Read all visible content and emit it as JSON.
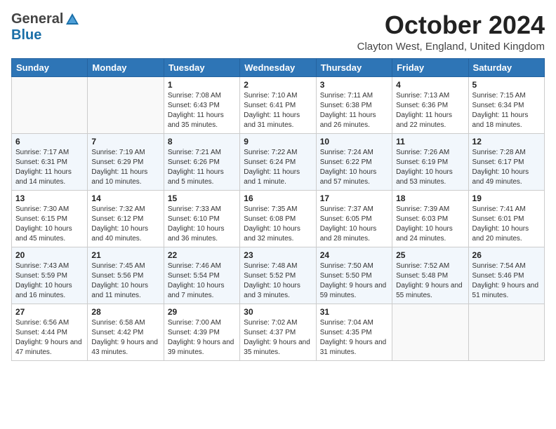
{
  "header": {
    "logo_general": "General",
    "logo_blue": "Blue",
    "month_title": "October 2024",
    "location": "Clayton West, England, United Kingdom"
  },
  "weekdays": [
    "Sunday",
    "Monday",
    "Tuesday",
    "Wednesday",
    "Thursday",
    "Friday",
    "Saturday"
  ],
  "weeks": [
    [
      {
        "day": "",
        "detail": ""
      },
      {
        "day": "",
        "detail": ""
      },
      {
        "day": "1",
        "detail": "Sunrise: 7:08 AM\nSunset: 6:43 PM\nDaylight: 11 hours and 35 minutes."
      },
      {
        "day": "2",
        "detail": "Sunrise: 7:10 AM\nSunset: 6:41 PM\nDaylight: 11 hours and 31 minutes."
      },
      {
        "day": "3",
        "detail": "Sunrise: 7:11 AM\nSunset: 6:38 PM\nDaylight: 11 hours and 26 minutes."
      },
      {
        "day": "4",
        "detail": "Sunrise: 7:13 AM\nSunset: 6:36 PM\nDaylight: 11 hours and 22 minutes."
      },
      {
        "day": "5",
        "detail": "Sunrise: 7:15 AM\nSunset: 6:34 PM\nDaylight: 11 hours and 18 minutes."
      }
    ],
    [
      {
        "day": "6",
        "detail": "Sunrise: 7:17 AM\nSunset: 6:31 PM\nDaylight: 11 hours and 14 minutes."
      },
      {
        "day": "7",
        "detail": "Sunrise: 7:19 AM\nSunset: 6:29 PM\nDaylight: 11 hours and 10 minutes."
      },
      {
        "day": "8",
        "detail": "Sunrise: 7:21 AM\nSunset: 6:26 PM\nDaylight: 11 hours and 5 minutes."
      },
      {
        "day": "9",
        "detail": "Sunrise: 7:22 AM\nSunset: 6:24 PM\nDaylight: 11 hours and 1 minute."
      },
      {
        "day": "10",
        "detail": "Sunrise: 7:24 AM\nSunset: 6:22 PM\nDaylight: 10 hours and 57 minutes."
      },
      {
        "day": "11",
        "detail": "Sunrise: 7:26 AM\nSunset: 6:19 PM\nDaylight: 10 hours and 53 minutes."
      },
      {
        "day": "12",
        "detail": "Sunrise: 7:28 AM\nSunset: 6:17 PM\nDaylight: 10 hours and 49 minutes."
      }
    ],
    [
      {
        "day": "13",
        "detail": "Sunrise: 7:30 AM\nSunset: 6:15 PM\nDaylight: 10 hours and 45 minutes."
      },
      {
        "day": "14",
        "detail": "Sunrise: 7:32 AM\nSunset: 6:12 PM\nDaylight: 10 hours and 40 minutes."
      },
      {
        "day": "15",
        "detail": "Sunrise: 7:33 AM\nSunset: 6:10 PM\nDaylight: 10 hours and 36 minutes."
      },
      {
        "day": "16",
        "detail": "Sunrise: 7:35 AM\nSunset: 6:08 PM\nDaylight: 10 hours and 32 minutes."
      },
      {
        "day": "17",
        "detail": "Sunrise: 7:37 AM\nSunset: 6:05 PM\nDaylight: 10 hours and 28 minutes."
      },
      {
        "day": "18",
        "detail": "Sunrise: 7:39 AM\nSunset: 6:03 PM\nDaylight: 10 hours and 24 minutes."
      },
      {
        "day": "19",
        "detail": "Sunrise: 7:41 AM\nSunset: 6:01 PM\nDaylight: 10 hours and 20 minutes."
      }
    ],
    [
      {
        "day": "20",
        "detail": "Sunrise: 7:43 AM\nSunset: 5:59 PM\nDaylight: 10 hours and 16 minutes."
      },
      {
        "day": "21",
        "detail": "Sunrise: 7:45 AM\nSunset: 5:56 PM\nDaylight: 10 hours and 11 minutes."
      },
      {
        "day": "22",
        "detail": "Sunrise: 7:46 AM\nSunset: 5:54 PM\nDaylight: 10 hours and 7 minutes."
      },
      {
        "day": "23",
        "detail": "Sunrise: 7:48 AM\nSunset: 5:52 PM\nDaylight: 10 hours and 3 minutes."
      },
      {
        "day": "24",
        "detail": "Sunrise: 7:50 AM\nSunset: 5:50 PM\nDaylight: 9 hours and 59 minutes."
      },
      {
        "day": "25",
        "detail": "Sunrise: 7:52 AM\nSunset: 5:48 PM\nDaylight: 9 hours and 55 minutes."
      },
      {
        "day": "26",
        "detail": "Sunrise: 7:54 AM\nSunset: 5:46 PM\nDaylight: 9 hours and 51 minutes."
      }
    ],
    [
      {
        "day": "27",
        "detail": "Sunrise: 6:56 AM\nSunset: 4:44 PM\nDaylight: 9 hours and 47 minutes."
      },
      {
        "day": "28",
        "detail": "Sunrise: 6:58 AM\nSunset: 4:42 PM\nDaylight: 9 hours and 43 minutes."
      },
      {
        "day": "29",
        "detail": "Sunrise: 7:00 AM\nSunset: 4:39 PM\nDaylight: 9 hours and 39 minutes."
      },
      {
        "day": "30",
        "detail": "Sunrise: 7:02 AM\nSunset: 4:37 PM\nDaylight: 9 hours and 35 minutes."
      },
      {
        "day": "31",
        "detail": "Sunrise: 7:04 AM\nSunset: 4:35 PM\nDaylight: 9 hours and 31 minutes."
      },
      {
        "day": "",
        "detail": ""
      },
      {
        "day": "",
        "detail": ""
      }
    ]
  ]
}
